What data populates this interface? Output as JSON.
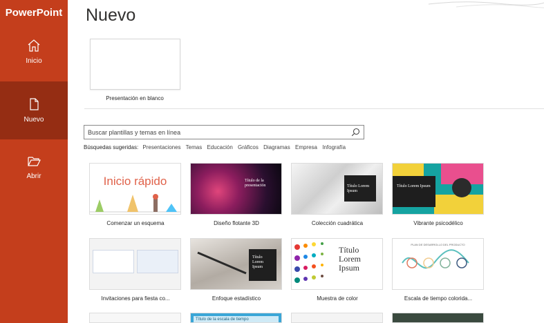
{
  "app": {
    "name": "PowerPoint"
  },
  "sidebar": {
    "items": [
      {
        "label": "Inicio",
        "icon": "home-icon"
      },
      {
        "label": "Nuevo",
        "icon": "new-file-icon",
        "selected": true
      },
      {
        "label": "Abrir",
        "icon": "folder-open-icon"
      }
    ]
  },
  "colors": {
    "sidebar": "#c43e1c",
    "sidebar_selected": "#952d13",
    "accent": "#e0624a"
  },
  "main": {
    "title": "Nuevo",
    "blank": {
      "label": "Presentación en blanco"
    },
    "search": {
      "placeholder": "Buscar plantillas y temas en línea",
      "icon": "search-icon"
    },
    "suggestions": {
      "label": "Búsquedas sugeridas:",
      "items": [
        "Presentaciones",
        "Temas",
        "Educación",
        "Gráficos",
        "Diagramas",
        "Empresa",
        "Infografía"
      ]
    },
    "templates": [
      {
        "name": "Comenzar un esquema",
        "thumb_text": "Inicio rápido"
      },
      {
        "name": "Diseño flotante 3D",
        "thumb_text": "Título de la presentación"
      },
      {
        "name": "Colección cuadrática",
        "thumb_text": "Título Lorem Ipsum"
      },
      {
        "name": "Vibrante psicodélico",
        "thumb_text": "Título Lorem Ipsum"
      },
      {
        "name": "Invitaciones para fiesta co...",
        "thumb_text": ""
      },
      {
        "name": "Enfoque estadístico",
        "thumb_text": "Título Lorem Ipsum"
      },
      {
        "name": "Muestra de color",
        "thumb_text": "Título Lorem Ipsum"
      },
      {
        "name": "Escala de tiempo colorida...",
        "thumb_text": "PLAN DE DESARROLLO DEL PRODUCTO"
      },
      {
        "name": "",
        "thumb_text": ""
      },
      {
        "name": "",
        "thumb_text": "Título de la escala de tiempo"
      },
      {
        "name": "",
        "thumb_text": ""
      },
      {
        "name": "",
        "thumb_text": ""
      }
    ]
  }
}
